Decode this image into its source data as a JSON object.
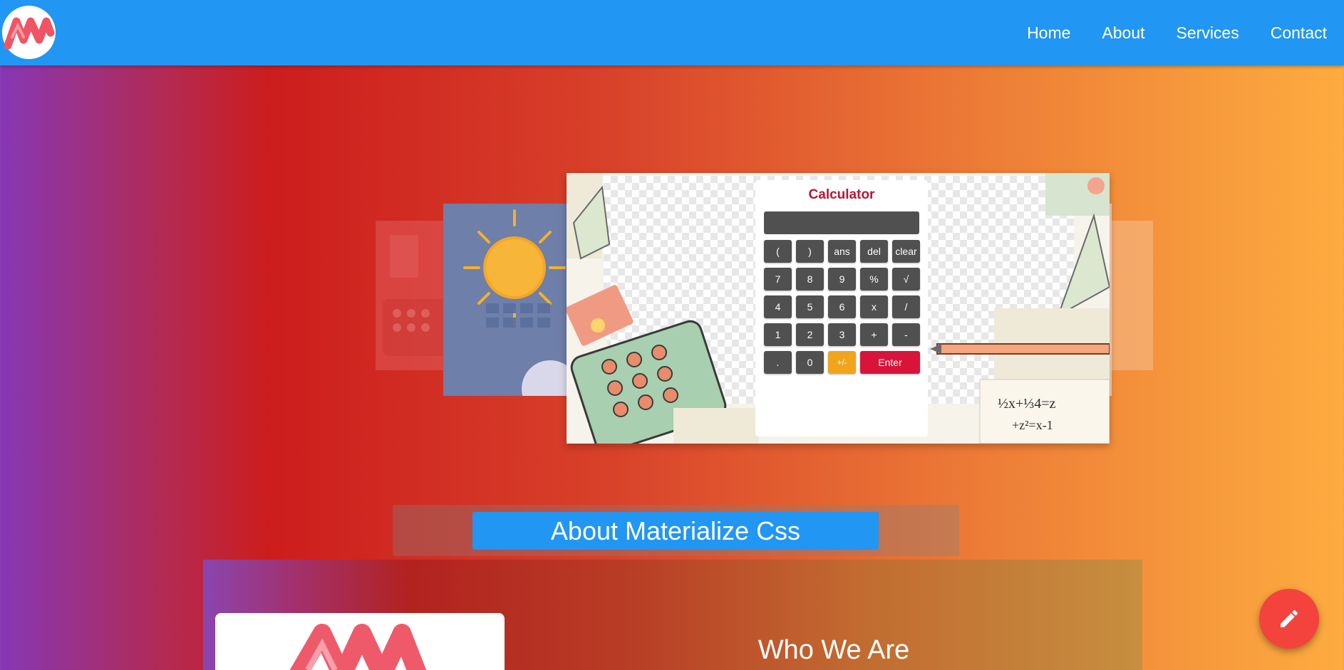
{
  "nav": {
    "links": [
      {
        "label": "Home"
      },
      {
        "label": "About"
      },
      {
        "label": "Services"
      },
      {
        "label": "Contact"
      }
    ],
    "bar_color": "#2196f3",
    "logo_icon": "materialize-m-logo-icon"
  },
  "calculator": {
    "title": "Calculator",
    "display_value": "",
    "buttons": [
      [
        "(",
        ")",
        "ans",
        "del",
        "clear"
      ],
      [
        "7",
        "8",
        "9",
        "%",
        "√"
      ],
      [
        "4",
        "5",
        "6",
        "x",
        "/"
      ],
      [
        "1",
        "2",
        "3",
        "+",
        "-"
      ],
      [
        ".",
        "0",
        "+/-",
        "Enter"
      ]
    ],
    "accent_color": "#f0a51d",
    "enter_color": "#d8143a"
  },
  "about": {
    "section_title": "About Materialize Css",
    "heading": "Who We Are"
  },
  "fab": {
    "icon": "pencil-edit-icon",
    "color": "#f4433d"
  }
}
